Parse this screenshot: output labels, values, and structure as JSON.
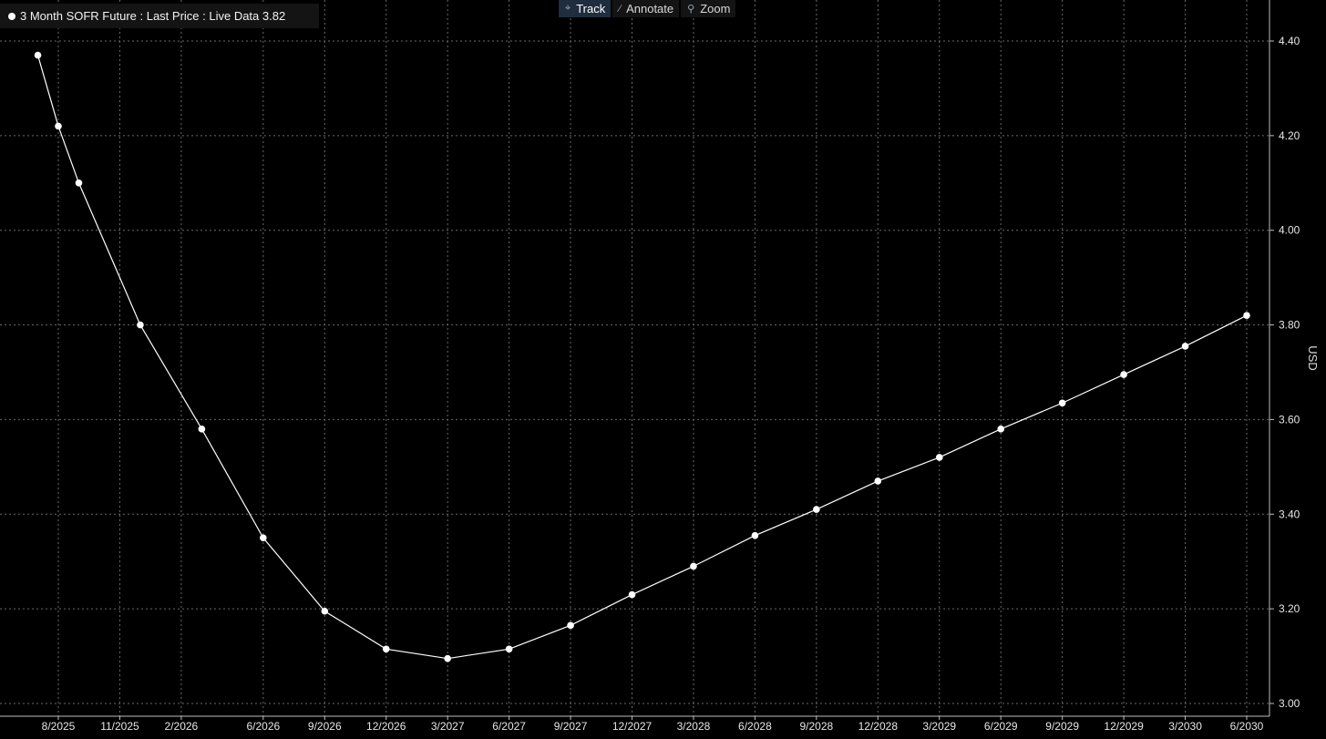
{
  "legend": {
    "label": "3 Month SOFR Future : Last Price : Live Data 3.82"
  },
  "toolbar": {
    "items": [
      {
        "label": "Track",
        "icon": "crosshair-icon",
        "active": true
      },
      {
        "label": "Annotate",
        "icon": "pencil-icon",
        "active": false
      },
      {
        "label": "Zoom",
        "icon": "magnifier-icon",
        "active": false
      }
    ]
  },
  "colors": {
    "background": "#000000",
    "line": "#ffffff",
    "grid": "#6a6a6a",
    "toolbar_active": "#1f2d3f",
    "panel": "#141414"
  },
  "chart_data": {
    "type": "line",
    "ylabel": "USD",
    "xlabel": "",
    "ylim": [
      3.0,
      4.4
    ],
    "y_ticks": [
      "4.40",
      "4.20",
      "4.00",
      "3.80",
      "3.60",
      "3.40",
      "3.20",
      "3.00"
    ],
    "y_axis_position": "right",
    "grid": true,
    "x_ticks": [
      "8/2025",
      "11/2025",
      "2/2026",
      "6/2026",
      "9/2026",
      "12/2026",
      "3/2027",
      "6/2027",
      "9/2027",
      "12/2027",
      "3/2028",
      "6/2028",
      "9/2028",
      "12/2028",
      "3/2029",
      "6/2029",
      "9/2029",
      "12/2029",
      "3/2030",
      "6/2030"
    ],
    "series": [
      {
        "x": [
          "7/2025",
          "8/2025",
          "9/2025",
          "12/2025",
          "3/2026",
          "6/2026",
          "9/2026",
          "12/2026",
          "3/2027",
          "6/2027",
          "9/2027",
          "12/2027",
          "3/2028",
          "6/2028",
          "9/2028",
          "12/2028",
          "3/2029",
          "6/2029",
          "9/2029",
          "12/2029",
          "3/2030",
          "6/2030"
        ],
        "values": [
          4.37,
          4.22,
          4.1,
          3.8,
          3.58,
          3.35,
          3.195,
          3.115,
          3.095,
          3.115,
          3.165,
          3.23,
          3.29,
          3.355,
          3.41,
          3.47,
          3.52,
          3.58,
          3.635,
          3.695,
          3.755,
          3.82
        ]
      }
    ]
  }
}
